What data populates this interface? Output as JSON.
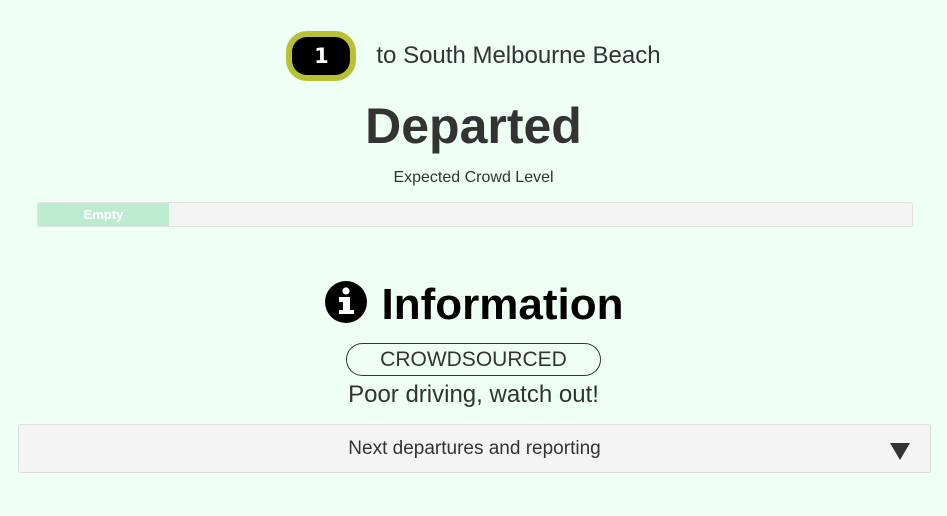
{
  "route": {
    "number": "1",
    "destination": "to South Melbourne Beach",
    "badge_color": "#000000",
    "badge_border_color": "#b6c234"
  },
  "status": {
    "title": "Departed"
  },
  "crowd": {
    "label": "Expected Crowd Level",
    "level_text": "Empty",
    "level_fraction": 0.15,
    "fill_color": "#bdebd0"
  },
  "information": {
    "icon": "info-circle-icon",
    "title": "Information",
    "source_badge": "CROWDSOURCED",
    "message": "Poor driving, watch out!"
  },
  "accordion": {
    "label": "Next departures and reporting",
    "icon": "triangle-down-icon"
  },
  "colors": {
    "background": "#eefff4",
    "text": "#333333"
  }
}
